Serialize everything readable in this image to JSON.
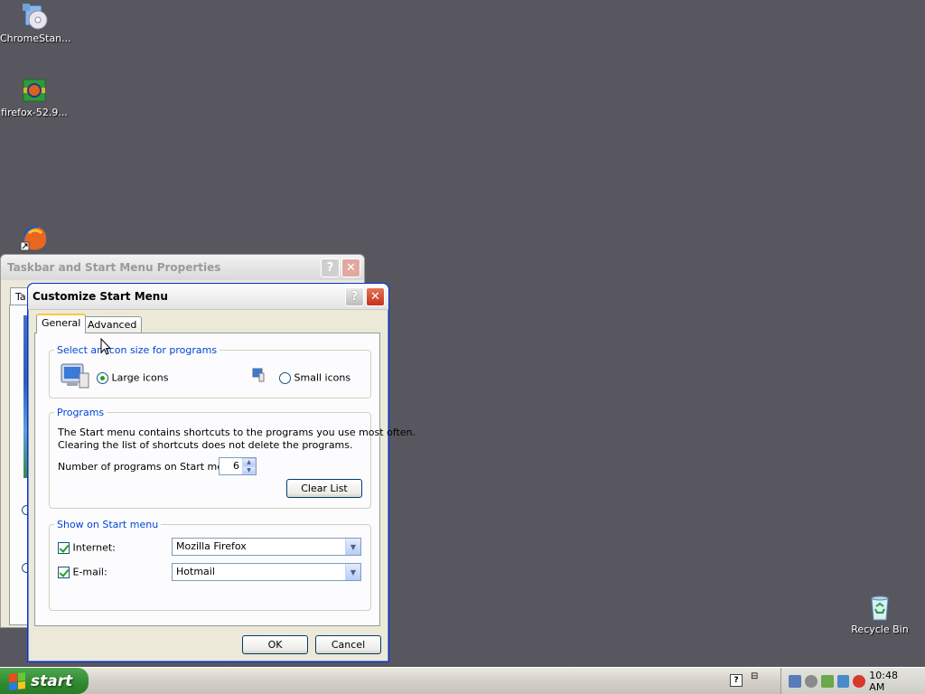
{
  "desktop": {
    "icons": [
      {
        "label": "ChromeStan..."
      },
      {
        "label": "firefox-52.9..."
      },
      {
        "label": ""
      },
      {
        "label": "Recycle Bin"
      }
    ]
  },
  "back_window": {
    "title": "Taskbar and Start Menu Properties",
    "tab_partial": "Ta",
    "help_label": "?",
    "close_label": "✕"
  },
  "dialog": {
    "title": "Customize Start Menu",
    "help_label": "?",
    "close_label": "✕",
    "tabs": [
      {
        "label": "General",
        "active": true
      },
      {
        "label": "Advanced",
        "active": false
      }
    ],
    "icon_size_group": {
      "legend": "Select an icon size for programs",
      "large_label": "Large icons",
      "small_label": "Small icons",
      "selected": "large"
    },
    "programs_group": {
      "legend": "Programs",
      "description_line1": "The Start menu contains shortcuts to the programs you use most often.",
      "description_line2": "Clearing the list of shortcuts does not delete the programs.",
      "count_label": "Number of programs on Start menu:",
      "count_value": "6",
      "clear_button": "Clear List"
    },
    "show_group": {
      "legend": "Show on Start menu",
      "internet_label": "Internet:",
      "internet_checked": true,
      "internet_value": "Mozilla Firefox",
      "email_label": "E-mail:",
      "email_checked": true,
      "email_value": "Hotmail"
    },
    "ok_button": "OK",
    "cancel_button": "Cancel"
  },
  "taskbar": {
    "start_label": "start",
    "clock": "10:48 AM",
    "lang_indicator": "?"
  },
  "colors": {
    "desktop": "#58575f",
    "titlebar_active_border": "#0831d9",
    "legend_text": "#0046d5",
    "start_button": "#2f8a2f"
  }
}
